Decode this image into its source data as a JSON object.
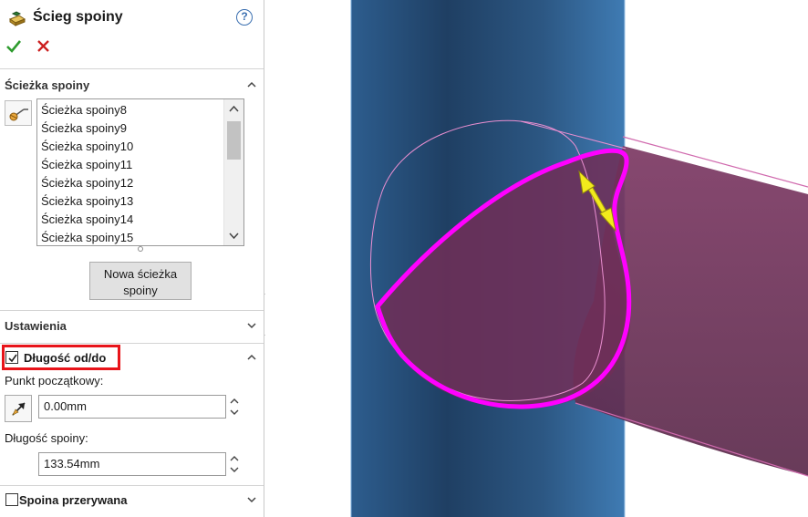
{
  "property_manager": {
    "title": "Ścieg spoiny",
    "help_label": "?",
    "weld_path_section": {
      "header": "Ścieżka spoiny",
      "items": [
        "Ścieżka spoiny8",
        "Ścieżka spoiny9",
        "Ścieżka spoiny10",
        "Ścieżka spoiny11",
        "Ścieżka spoiny12",
        "Ścieżka spoiny13",
        "Ścieżka spoiny14",
        "Ścieżka spoiny15"
      ],
      "new_path_button": "Nowa ścieżka\nspoiny"
    },
    "settings_section": {
      "header": "Ustawienia"
    },
    "from_to_section": {
      "header": "Długość od/do",
      "checked": true,
      "start_point_label": "Punkt początkowy:",
      "start_point_value": "0.00mm",
      "weld_length_label": "Długość spoiny:",
      "weld_length_value": "133.54mm"
    },
    "intermittent_section": {
      "header": "Spoina przerywana",
      "checked": false
    }
  },
  "colors": {
    "highlight_box": "#e8141a",
    "weld_path": "#ff00ff",
    "vertical_pipe": "#2f5e88",
    "branch_pipe": "#6b2e55",
    "drag_handle": "#f2ea1c",
    "ok_check": "#2e9b2e",
    "cancel_x": "#cc1f1f"
  },
  "icons": {
    "title": "weld-bead-icon",
    "help": "help-icon",
    "ok": "check-icon",
    "cancel": "close-icon",
    "path_select": "weld-path-select-icon",
    "start_point": "arrow-start-point-icon",
    "drag_handle": "double-arrow-handle-icon"
  }
}
